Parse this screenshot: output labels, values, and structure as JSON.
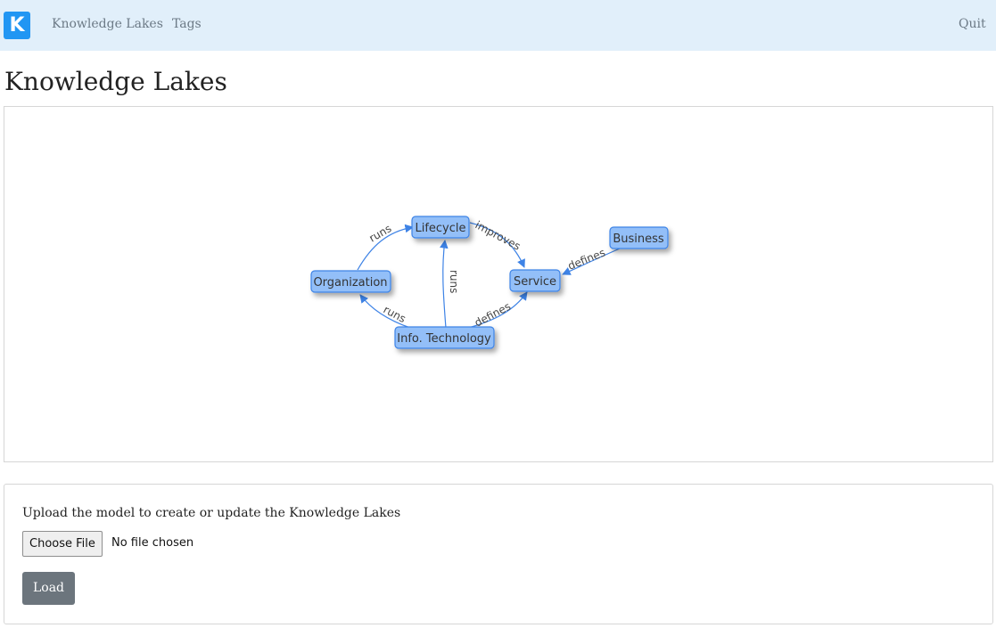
{
  "navbar": {
    "logo_letter": "K",
    "links": [
      "Knowledge Lakes",
      "Tags"
    ],
    "quit_label": "Quit"
  },
  "page": {
    "title": "Knowledge Lakes"
  },
  "graph": {
    "nodes": [
      {
        "id": "lifecycle",
        "label": "Lifecycle"
      },
      {
        "id": "organization",
        "label": "Organization"
      },
      {
        "id": "service",
        "label": "Service"
      },
      {
        "id": "business",
        "label": "Business"
      },
      {
        "id": "it",
        "label": "Info. Technology"
      }
    ],
    "edges": [
      {
        "from": "organization",
        "to": "lifecycle",
        "label": "runs"
      },
      {
        "from": "lifecycle",
        "to": "service",
        "label": "improves"
      },
      {
        "from": "business",
        "to": "service",
        "label": "defines"
      },
      {
        "from": "it",
        "to": "lifecycle",
        "label": "runs"
      },
      {
        "from": "it",
        "to": "organization",
        "label": "runs"
      },
      {
        "from": "it",
        "to": "service",
        "label": "defines"
      }
    ],
    "colors": {
      "node_fill": "#93bff8",
      "node_stroke": "#3e83e6",
      "edge": "#3e83e6"
    }
  },
  "upload": {
    "instruction": "Upload the model to create or update the Knowledge Lakes",
    "choose_file_label": "Choose File",
    "file_status": "No file chosen",
    "load_label": "Load"
  }
}
